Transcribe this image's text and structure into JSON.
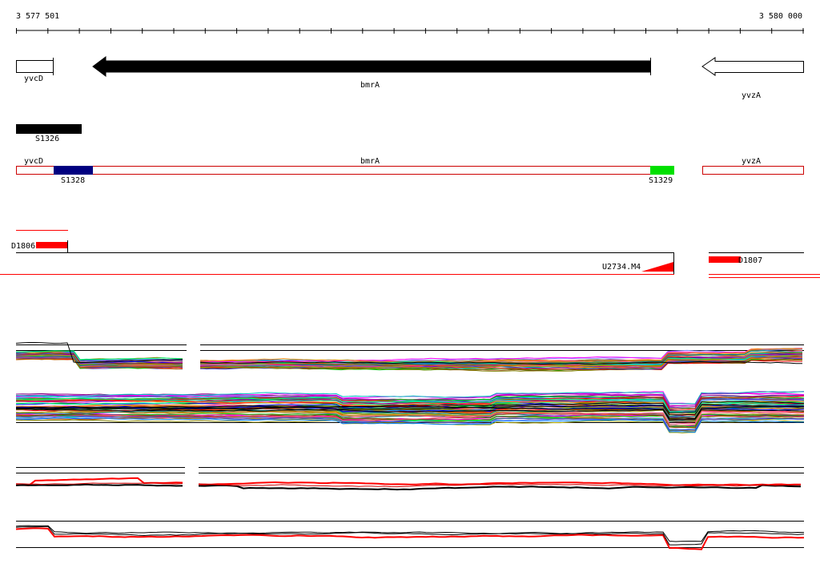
{
  "coordinates": {
    "start_label": "3 577 501",
    "end_label": "3 580 000"
  },
  "genes": [
    {
      "id": "yvcD",
      "label": "yvcD",
      "strand": "reverse",
      "style": "outline",
      "start": 3577501,
      "end": 3577618
    },
    {
      "id": "bmrA",
      "label": "bmrA",
      "strand": "reverse",
      "style": "filled",
      "start": 3577744,
      "end": 3579489
    },
    {
      "id": "yvzA",
      "label": "yvzA",
      "strand": "reverse",
      "style": "outline",
      "start": 3579644,
      "end": 3580000
    }
  ],
  "segments": [
    {
      "id": "S1326",
      "label": "S1326",
      "start": 3577501,
      "end": 3577712,
      "color": "#000000"
    }
  ],
  "transcript_track": {
    "labels": [
      {
        "id": "yvcD",
        "text": "yvcD"
      },
      {
        "id": "bmrA",
        "text": "bmrA"
      },
      {
        "id": "yvzA",
        "text": "yvzA"
      }
    ],
    "features": [
      {
        "id": "S1328",
        "label": "S1328",
        "start": 3577618,
        "end": 3577747,
        "color": "#000080"
      },
      {
        "id": "S1329",
        "label": "S1329",
        "start": 3579489,
        "end": 3579565,
        "color": "#00e000"
      }
    ]
  },
  "markers": [
    {
      "id": "D1806",
      "label": "D1806"
    },
    {
      "id": "D1807",
      "label": "D1807"
    },
    {
      "id": "U2734",
      "label": "U2734.M4"
    }
  ],
  "colors": {
    "feature_outline": "#cc0000",
    "marker": "#ff0000",
    "gene": "#000000"
  }
}
